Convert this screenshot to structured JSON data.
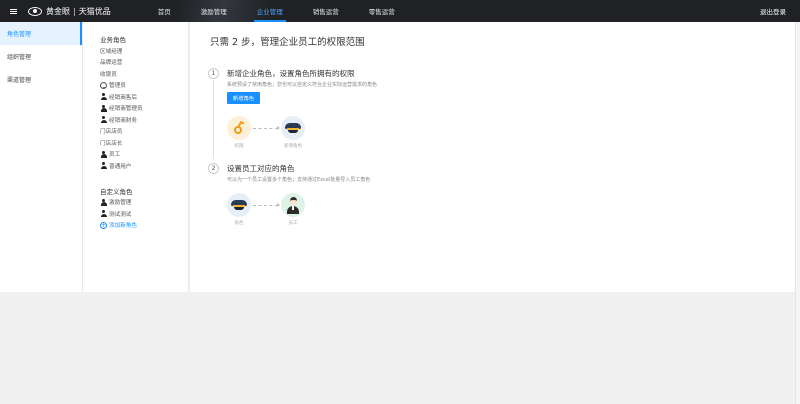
{
  "header": {
    "brand_name": "黄金眼",
    "brand_sep": "|",
    "brand_sub": "天猫优品",
    "nav": [
      {
        "label": "首页",
        "active": false
      },
      {
        "label": "激励管理",
        "active": false
      },
      {
        "label": "企业管理",
        "active": true
      },
      {
        "label": "销售运营",
        "active": false
      },
      {
        "label": "零售运营",
        "active": false
      }
    ],
    "logout": "退出登录",
    "accent": "#1890ff"
  },
  "sidebar": {
    "items": [
      {
        "label": "角色管理",
        "active": true
      },
      {
        "label": "组织管理",
        "active": false
      },
      {
        "label": "渠道管理",
        "active": false
      }
    ]
  },
  "roles": {
    "business_title": "业务角色",
    "business": [
      {
        "label": "区域经理",
        "icon": "none"
      },
      {
        "label": "品牌运营",
        "icon": "none"
      },
      {
        "label": "收银员",
        "icon": "none"
      },
      {
        "label": "管理员",
        "icon": "smiley-icon"
      },
      {
        "label": "经销商售后",
        "icon": "user-icon"
      },
      {
        "label": "经销商管理员",
        "icon": "user-icon"
      },
      {
        "label": "经销商财务",
        "icon": "user-icon"
      },
      {
        "label": "门店店员",
        "icon": "none"
      },
      {
        "label": "门店店长",
        "icon": "none"
      },
      {
        "label": "员工",
        "icon": "user-icon"
      },
      {
        "label": "普通用户",
        "icon": "user-icon"
      }
    ],
    "custom_title": "自定义角色",
    "custom": [
      {
        "label": "激励管理",
        "icon": "user-icon"
      },
      {
        "label": "测试测试",
        "icon": "user-icon"
      }
    ],
    "add_label": "添加新角色"
  },
  "main": {
    "title": "只需 2 步，管理企业员工的权限范围",
    "step1": {
      "num": "1",
      "title": "新增企业角色，设置角色所拥有的权限",
      "desc": "系统预设了常用角色；您也可以自定义符合企业实际运营需求的角色",
      "button": "新增角色",
      "from_label": "权限",
      "to_label": "新增角色"
    },
    "step2": {
      "num": "2",
      "title": "设置员工对应的角色",
      "desc": "可以为一个员工设置多个角色；支持通过Excel批量导入员工角色",
      "from_label": "角色",
      "to_label": "员工"
    }
  }
}
